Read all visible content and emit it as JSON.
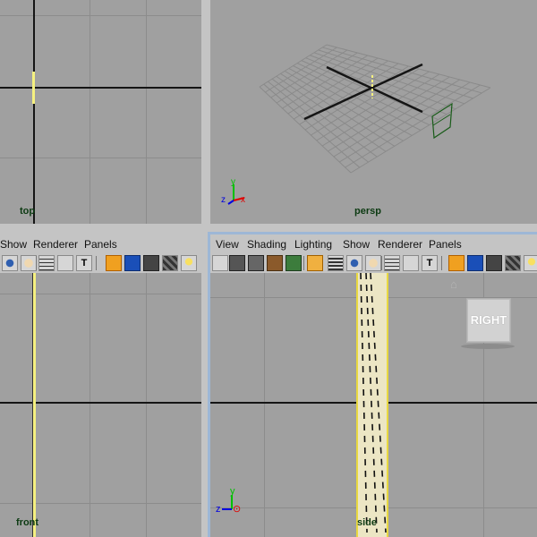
{
  "viewports": {
    "top": {
      "label": "top"
    },
    "persp": {
      "label": "persp"
    },
    "front": {
      "label": "front"
    },
    "side": {
      "label": "side"
    }
  },
  "front_menu": [
    "Show",
    "Renderer",
    "Panels"
  ],
  "side_menu": [
    "View",
    "Shading",
    "Lighting",
    "Show",
    "Renderer",
    "Panels"
  ],
  "viewcube": {
    "label": "RIGHT"
  },
  "axes": {
    "x": "x",
    "y": "y",
    "z": "z"
  },
  "colors": {
    "viewport_bg": "#a0a0a0",
    "panel_bg": "#c4c4c4",
    "grid": "#8c8c8c",
    "axis": "#151515",
    "selection": "#f5f080",
    "label": "#0c3a12",
    "active_border": "#9db7d6"
  }
}
